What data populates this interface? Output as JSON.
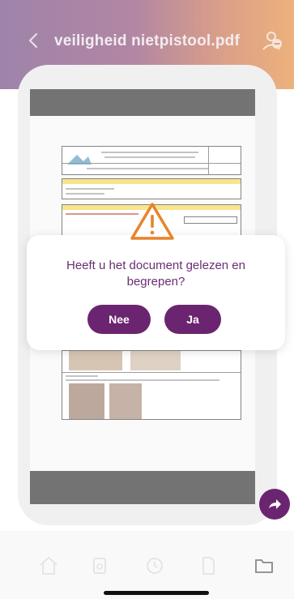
{
  "header": {
    "title": "veiligheid nietpistool.pdf",
    "back_icon": "chevron-left-icon",
    "user_icon": "user-minus-icon"
  },
  "dialog": {
    "message": "Heeft u het document gelezen en begrepen?",
    "no_label": "Nee",
    "yes_label": "Ja",
    "icon": "warning-triangle-icon"
  },
  "share_button": {
    "icon": "share-arrow-icon"
  },
  "bottom_nav": {
    "items": [
      "home-icon",
      "documents-icon",
      "clock-icon",
      "file-icon",
      "folder-icon"
    ]
  },
  "colors": {
    "primary": "#6b2570",
    "header_start": "#5a2a6e",
    "header_end": "#e07a1f",
    "warning": "#e8832a"
  }
}
